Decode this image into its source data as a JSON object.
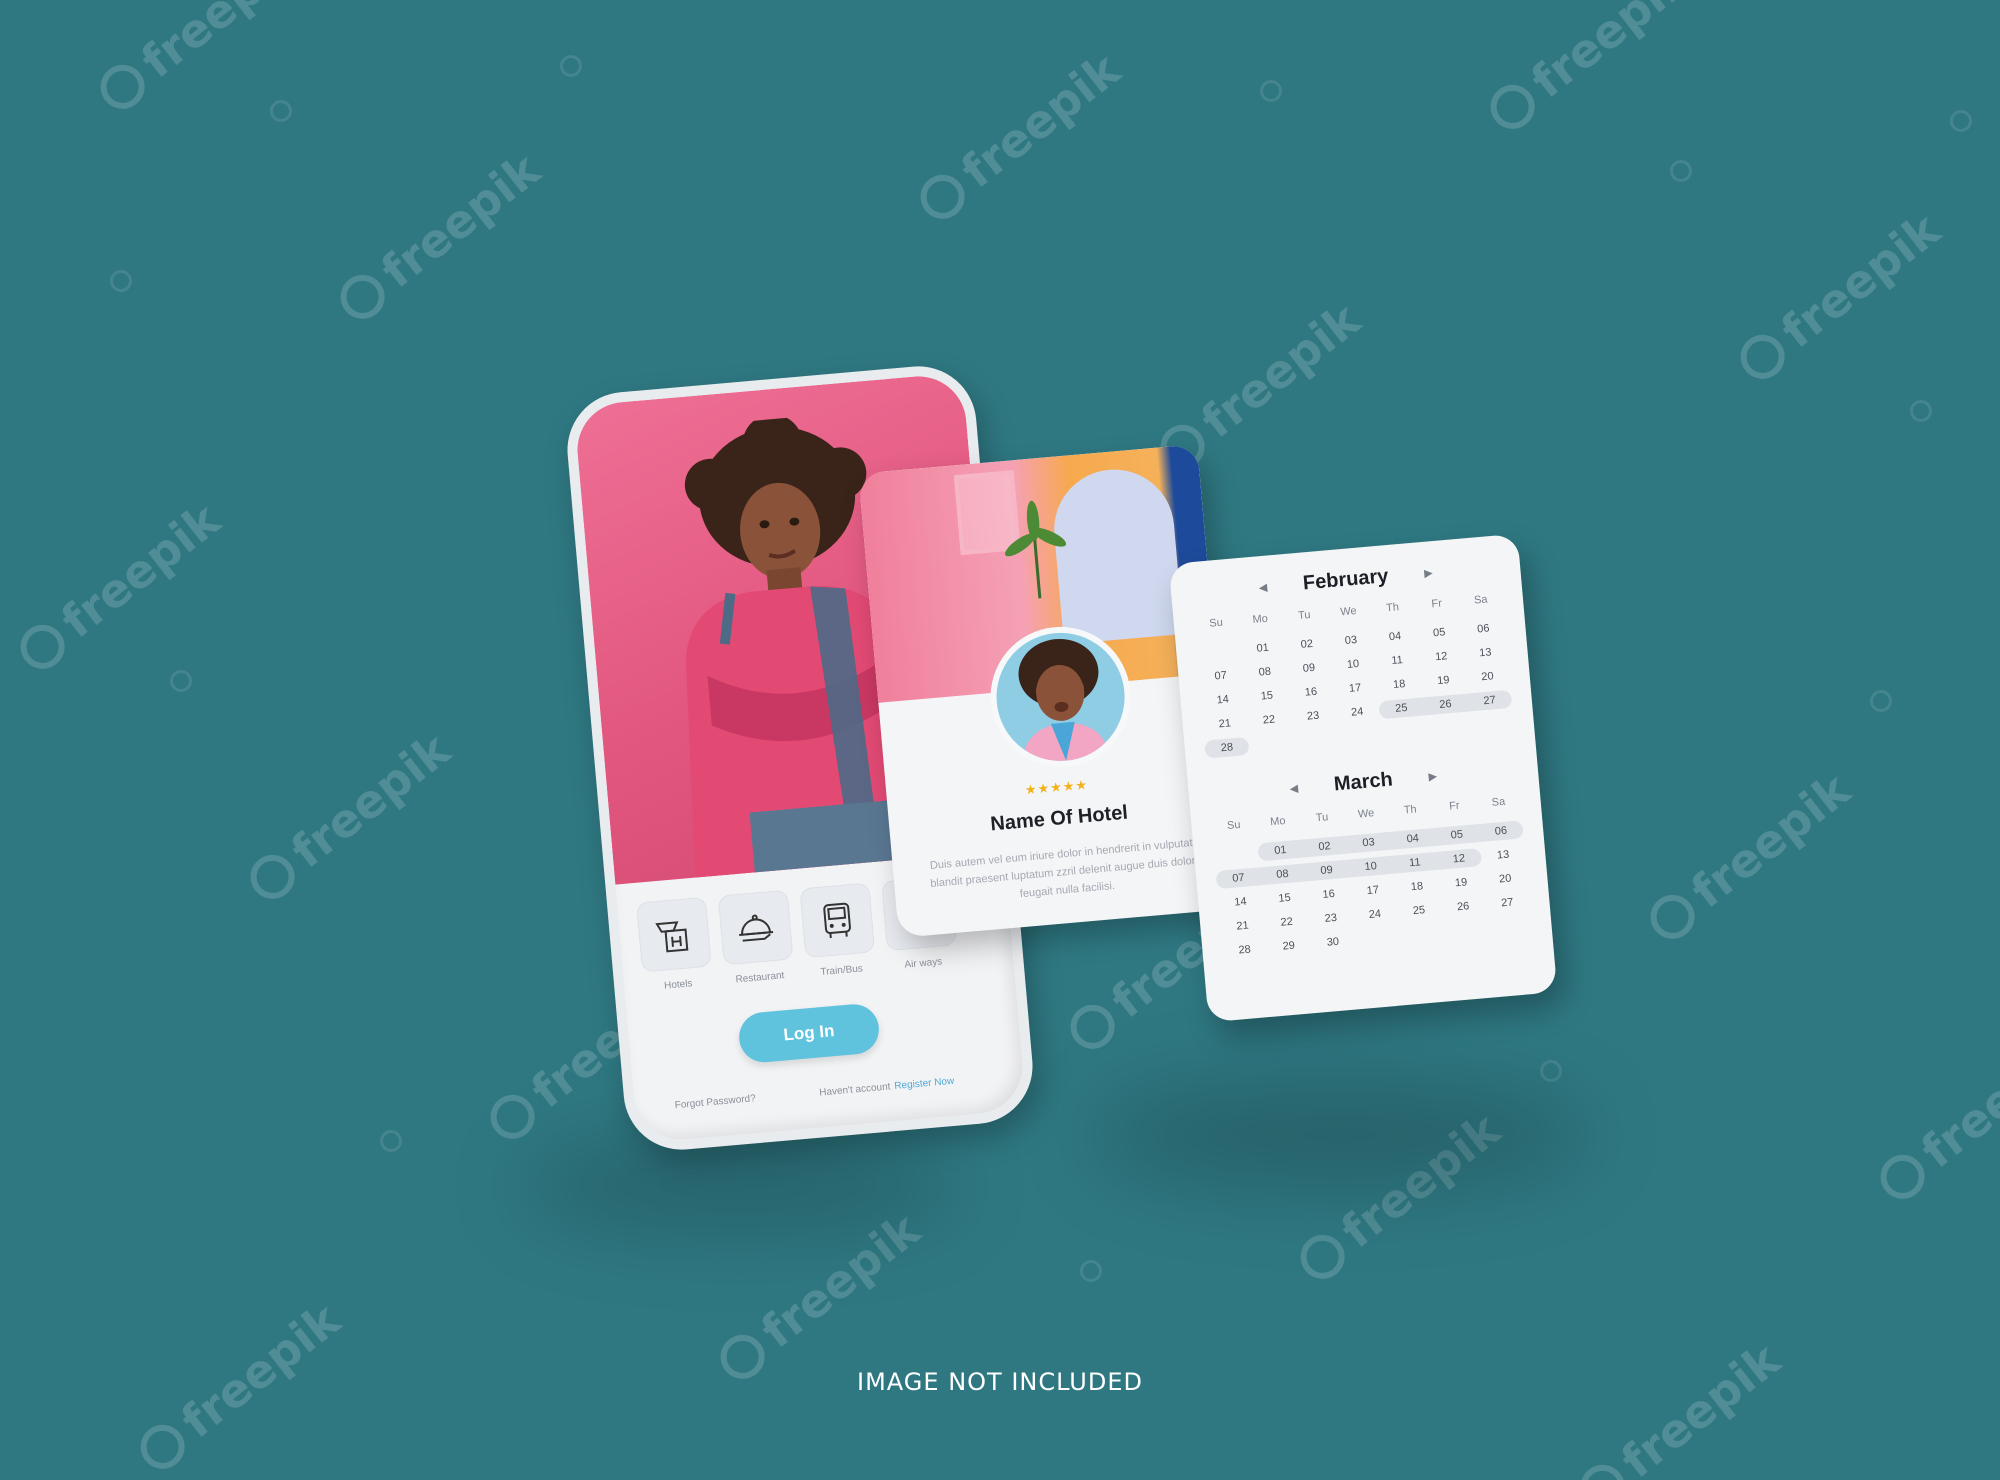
{
  "watermark": {
    "text": "freepik"
  },
  "login_screen": {
    "categories": [
      {
        "label": "Hotels",
        "icon": "hotel-icon"
      },
      {
        "label": "Restaurant",
        "icon": "restaurant-cloche-icon"
      },
      {
        "label": "Train/Bus",
        "icon": "bus-icon"
      },
      {
        "label": "Air ways",
        "icon": "airplane-icon"
      }
    ],
    "login_label": "Log In",
    "forgot_password": "Forgot Password?",
    "no_account_text": "Haven't account",
    "register_link": "Register Now",
    "accent_color": "#5fc3dd"
  },
  "hotel_card": {
    "rating": "★★★★★",
    "name": "Name Of Hotel",
    "description": "Duis autem vel eum iriure dolor in hendrerit in vulputate blandit praesent luptatum zzril delenit augue duis dolore feugait nulla facilisi."
  },
  "calendar": {
    "weekdays": [
      "Su",
      "Mo",
      "Tu",
      "We",
      "Th",
      "Fr",
      "Sa"
    ],
    "months": [
      {
        "name": "February",
        "days": [
          "",
          "01",
          "02",
          "03",
          "04",
          "05",
          "06",
          "07",
          "08",
          "09",
          "10",
          "11",
          "12",
          "13",
          "14",
          "15",
          "16",
          "17",
          "18",
          "19",
          "20",
          "21",
          "22",
          "23",
          "24",
          "25",
          "26",
          "27",
          "28"
        ],
        "selected_range": [
          "25",
          "28"
        ]
      },
      {
        "name": "March",
        "days": [
          "",
          "01",
          "02",
          "03",
          "04",
          "05",
          "06",
          "07",
          "08",
          "09",
          "10",
          "11",
          "12",
          "13",
          "14",
          "15",
          "16",
          "17",
          "18",
          "19",
          "20",
          "21",
          "22",
          "23",
          "24",
          "25",
          "26",
          "27",
          "28",
          "29",
          "30"
        ],
        "selected_range": [
          "01",
          "12"
        ]
      }
    ]
  },
  "footer_note": "IMAGE NOT INCLUDED"
}
